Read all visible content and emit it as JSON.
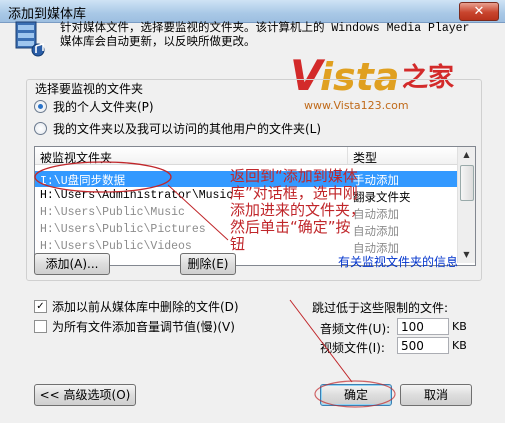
{
  "window": {
    "title": "添加到媒体库",
    "close_glyph": "✕"
  },
  "intro": {
    "text": "针对媒体文件，选择要监视的文件夹。该计算机上的 Windows Media Player 媒体库会自动更新，以反映所做更改。",
    "icon": "media-library-icon"
  },
  "watermark": {
    "logo_text": "Vista之家",
    "url_text": "www.Vista123.com"
  },
  "group": {
    "label": "选择要监视的文件夹",
    "radio_personal": "我的个人文件夹(P)",
    "radio_all": "我的文件夹以及我可以访问的其他用户的文件夹(L)"
  },
  "folder_list": {
    "columns": [
      "被监视文件夹",
      "类型"
    ],
    "rows": [
      {
        "path": "I:\\U盘同步数据",
        "type": "手动添加"
      },
      {
        "path": "H:\\Users\\Administrator\\Music",
        "type": "翻录文件夹"
      },
      {
        "path": "H:\\Users\\Public\\Music",
        "type": "自动添加"
      },
      {
        "path": "H:\\Users\\Public\\Pictures",
        "type": "自动添加"
      },
      {
        "path": "H:\\Users\\Public\\Videos",
        "type": "自动添加"
      }
    ]
  },
  "buttons": {
    "add": "添加(A)...",
    "remove": "删除(E)",
    "advanced": "<< 高级选项(O)",
    "ok": "确定",
    "cancel": "取消"
  },
  "link_text": "有关监视文件夹的信息",
  "options": {
    "readd_deleted": "添加以前从媒体库中删除的文件(D)",
    "volume_leveling": "为所有文件添加音量调节值(慢)(V)",
    "readd_checked": true,
    "volume_checked": false
  },
  "limits": {
    "heading": "跳过低于这些限制的文件:",
    "audio_label": "音频文件(U):",
    "audio_value": "100",
    "video_label": "视频文件(I):",
    "video_value": "500",
    "unit": "KB"
  },
  "annotation": "返回到“添加到媒体库”对话框，选中刚添加进来的文件夹，然后单击“确定”按钮",
  "colors": {
    "selection": "#3399ff",
    "annotation": "#c0262a",
    "link": "#0033cc"
  }
}
